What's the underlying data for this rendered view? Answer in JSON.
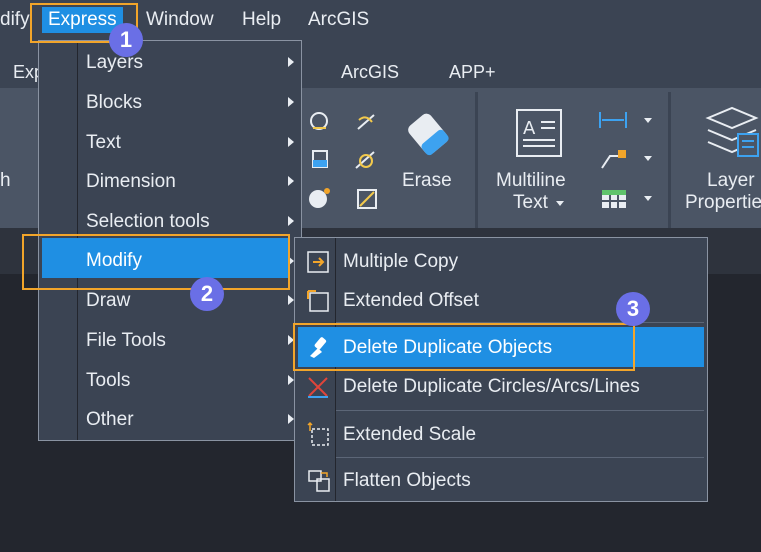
{
  "menubar": {
    "items": [
      "dify",
      "Express",
      "Window",
      "Help",
      "ArcGIS"
    ]
  },
  "tabs": [
    "Exp",
    "ArcGIS",
    "APP+"
  ],
  "ribbon": {
    "erase_label": "Erase",
    "multiline_text_line1": "Multiline",
    "multiline_text_line2": "Text",
    "layer_properties_line1": "Layer",
    "layer_properties_line2": "Propertie",
    "left_clipped": "h"
  },
  "express_menu": {
    "items": [
      "Layers",
      "Blocks",
      "Text",
      "Dimension",
      "Selection tools",
      "Modify",
      "Draw",
      "File Tools",
      "Tools",
      "Other"
    ],
    "highlighted": "Modify"
  },
  "modify_submenu": {
    "items": [
      "Multiple Copy",
      "Extended Offset",
      "Delete Duplicate Objects",
      "Delete Duplicate Circles/Arcs/Lines",
      "Extended Scale",
      "Flatten Objects"
    ],
    "highlighted": "Delete Duplicate Objects"
  },
  "badges": [
    "1",
    "2",
    "3"
  ],
  "colors": {
    "highlight": "#1f8fe3",
    "callout": "#f2a52a",
    "badge": "#6a6fe6"
  }
}
